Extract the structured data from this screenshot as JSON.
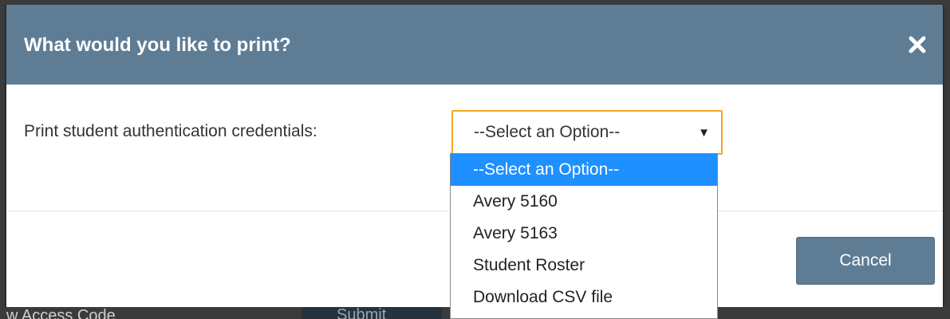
{
  "modal": {
    "title": "What would you like to print?",
    "close_icon": "close-icon",
    "form": {
      "label": "Print student authentication credentials:",
      "select": {
        "value": "--Select an Option--",
        "arrow": "▼",
        "options": [
          "--Select an Option--",
          "Avery 5160",
          "Avery 5163",
          "Student Roster",
          "Download CSV file"
        ],
        "highlighted_option": "--Select an Option--"
      }
    },
    "footer": {
      "cancel_label": "Cancel"
    }
  },
  "background": {
    "text": "w Access Code",
    "button_text": "Submit"
  },
  "colors": {
    "header": "#5e7d95",
    "select_border": "#f5a623",
    "option_highlight": "#1e90ff",
    "button": "#5e7d95"
  }
}
